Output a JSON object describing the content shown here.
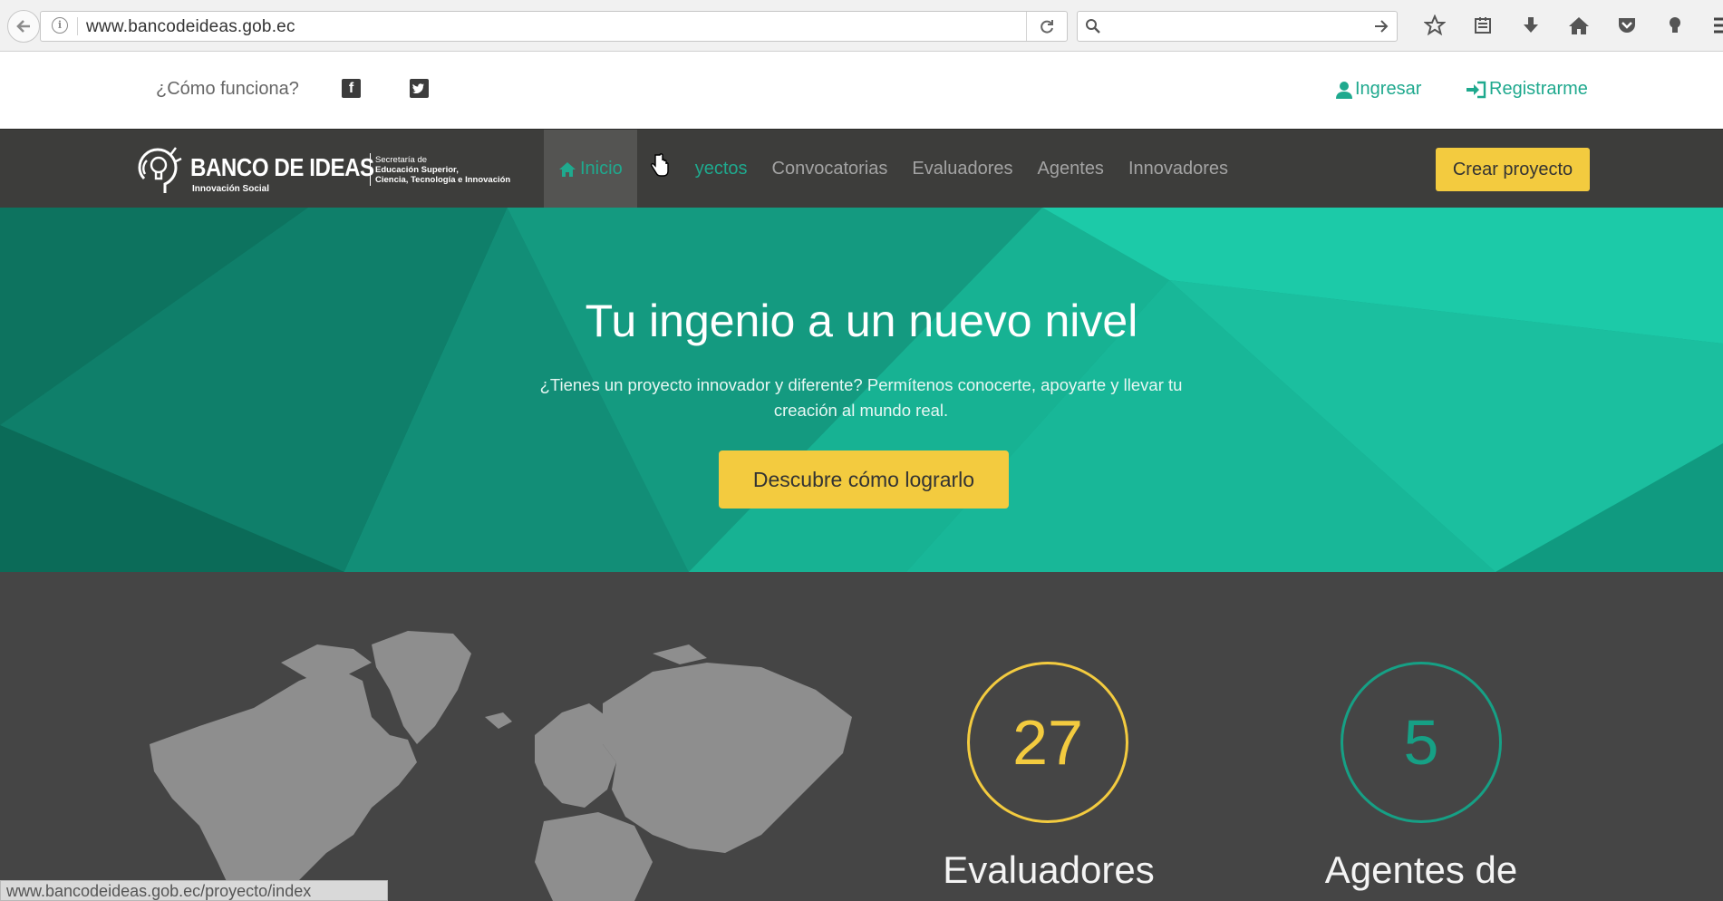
{
  "browser": {
    "url": "www.bancodeideas.gob.ec",
    "status_url": "www.bancodeideas.gob.ec/proyecto/index"
  },
  "topbar": {
    "how_it_works": "¿Cómo funciona?",
    "login": "Ingresar",
    "register": "Registrarme",
    "facebook_glyph": "f"
  },
  "logo": {
    "title": "BANCO DE IDEAS",
    "subtitle": "Innovación Social",
    "secretaria_1": "Secretaría de",
    "secretaria_2": "Educación Superior,",
    "secretaria_3": "Ciencia, Tecnología e Innovación"
  },
  "nav": {
    "items": [
      {
        "label": "Inicio"
      },
      {
        "label": "yectos"
      },
      {
        "label": "Convocatorias"
      },
      {
        "label": "Evaluadores"
      },
      {
        "label": "Agentes"
      },
      {
        "label": "Innovadores"
      }
    ],
    "create_button": "Crear proyecto"
  },
  "hero": {
    "title": "Tu ingenio a un nuevo nivel",
    "description": "¿Tienes un proyecto innovador y diferente? Permítenos conocerte, apoyarte y llevar tu creación al mundo real.",
    "button": "Descubre cómo lograrlo"
  },
  "stats": [
    {
      "value": "27",
      "label": "Evaluadores"
    },
    {
      "value": "5",
      "label": "Agentes de"
    }
  ],
  "colors": {
    "accent_green": "#1fa98e",
    "accent_yellow": "#f3cb3f",
    "nav_bg": "#3d3d3b",
    "stats_bg": "#454545"
  }
}
